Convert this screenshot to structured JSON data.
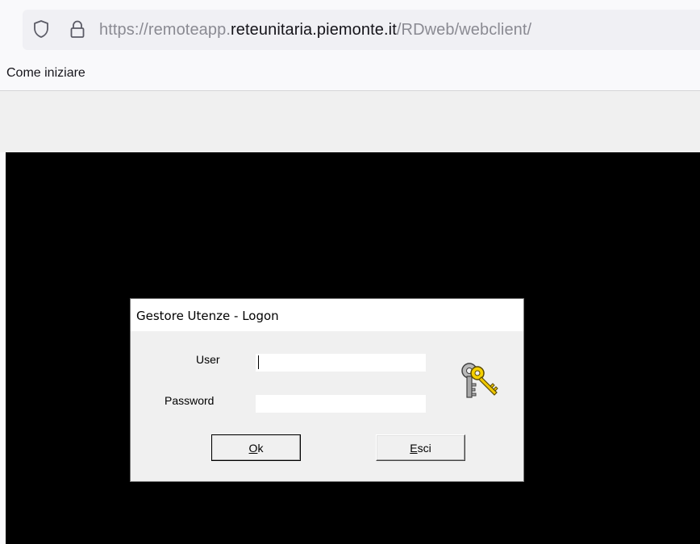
{
  "browser": {
    "url_prefix": "https://remoteapp.",
    "url_domain": "reteunitaria.piemonte.it",
    "url_path": "/RDweb/webclient/",
    "bookmark": "Come iniziare"
  },
  "dialog": {
    "title": "Gestore Utenze - Logon",
    "user_label": "User",
    "password_label": "Password",
    "user_value": "",
    "password_value": "",
    "ok_mnemonic": "O",
    "ok_rest": "k",
    "esci_mnemonic": "E",
    "esci_rest": "sci",
    "icon": "keys-icon"
  },
  "colors": {
    "remote_background": "#000000",
    "dialog_background": "#f0f0f0",
    "url_dim": "#8a8a92"
  }
}
